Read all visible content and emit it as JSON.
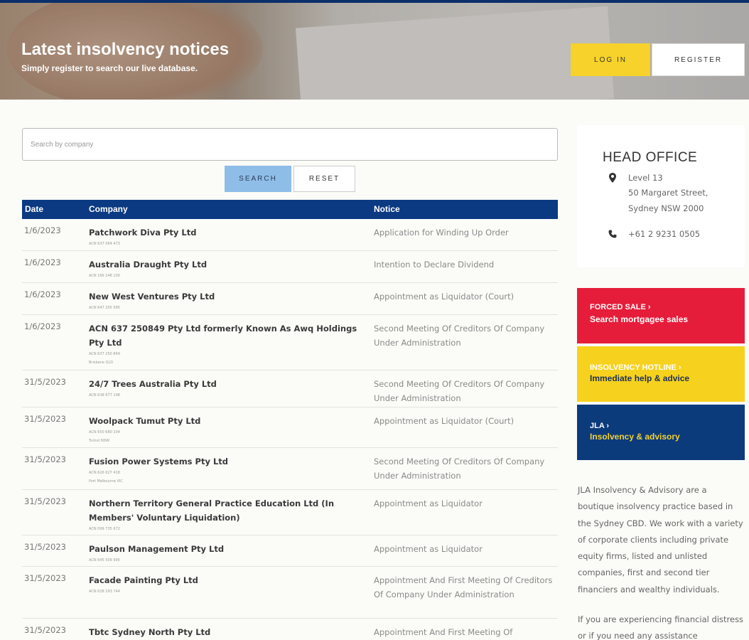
{
  "hero": {
    "title": "Latest insolvency notices",
    "subtitle": "Simply register to search our live database.",
    "login_label": "LOG IN",
    "register_label": "REGISTER"
  },
  "search": {
    "placeholder": "Search by company",
    "search_label": "SEARCH",
    "reset_label": "RESET"
  },
  "table": {
    "headers": {
      "date": "Date",
      "company": "Company",
      "notice": "Notice"
    },
    "rows": [
      {
        "date": "1/6/2023",
        "company": "Patchwork Diva Pty Ltd",
        "sub": [
          "ACN 637 064 473"
        ],
        "notice": "Application for Winding Up Order"
      },
      {
        "date": "1/6/2023",
        "company": "Australia Draught Pty Ltd",
        "sub": [
          "ACN 166 148 100"
        ],
        "notice": "Intention to Declare Dividend"
      },
      {
        "date": "1/6/2023",
        "company": "New West Ventures Pty Ltd",
        "sub": [
          "ACN 647 205 585"
        ],
        "notice": "Appointment as Liquidator (Court)"
      },
      {
        "date": "1/6/2023",
        "company": "ACN 637 250849 Pty Ltd formerly Known As Awq Holdings Pty Ltd",
        "sub": [
          "ACN 637 250 849",
          "Brisbane QLD"
        ],
        "notice": "Second Meeting Of Creditors Of Company Under Administration"
      },
      {
        "date": "31/5/2023",
        "company": "24/7 Trees Australia Pty Ltd",
        "sub": [
          "ACN 638 677 198"
        ],
        "notice": "Second Meeting Of Creditors Of Company Under Administration"
      },
      {
        "date": "31/5/2023",
        "company": "Woolpack Tumut Pty Ltd",
        "sub": [
          "ACN 650 680 204",
          "Tumut NSW"
        ],
        "notice": "Appointment as Liquidator (Court)"
      },
      {
        "date": "31/5/2023",
        "company": "Fusion Power Systems Pty Ltd",
        "sub": [
          "ACN 626 627 418",
          "Port Melbourne VIC"
        ],
        "notice": "Second Meeting Of Creditors Of Company Under Administration"
      },
      {
        "date": "31/5/2023",
        "company": "Northern Territory General Practice Education Ltd (In Members' Voluntary Liquidation)",
        "sub": [
          "ACN 099 735 672"
        ],
        "notice": "Appointment as Liquidator"
      },
      {
        "date": "31/5/2023",
        "company": "Paulson Management Pty Ltd",
        "sub": [
          "ACN 645 509 995"
        ],
        "notice": "Appointment as Liquidator"
      },
      {
        "date": "31/5/2023",
        "company": "Facade Painting Pty Ltd",
        "sub": [
          "ACN 628 293 744"
        ],
        "notice": "Appointment And First Meeting Of Creditors Of Company Under Administration"
      },
      {
        "date": "31/5/2023",
        "company": "Tbtc Sydney North Pty Ltd",
        "sub": [],
        "notice": "Appointment And First Meeting Of"
      }
    ]
  },
  "office": {
    "title": "HEAD OFFICE",
    "address": [
      "Level 13",
      "50 Margaret Street,",
      "Sydney NSW 2000"
    ],
    "phone": "+61 2 9231 0505"
  },
  "promos": [
    {
      "title": "FORCED SALE ›",
      "subtitle": "Search mortgagee sales",
      "bg": "#e61d3a",
      "title_color": "#ffffff",
      "sub_color": "#ffffff"
    },
    {
      "title": "INSOLVENCY HOTLINE ›",
      "subtitle": "Immediate help & advice",
      "bg": "#f6d21e",
      "title_color": "#ffffff",
      "sub_color": "#1d2f55"
    },
    {
      "title": "JLA ›",
      "subtitle": "Insolvency & advisory",
      "bg": "#0c3b7c",
      "title_color": "#ffffff",
      "sub_color": "#f2d230"
    }
  ],
  "about": {
    "paragraph1": "JLA Insolvency & Advisory are a boutique insolvency practice based in the Sydney CBD. We work with a variety of corporate clients including private equity firms, listed and unlisted companies, first and second tier financiers and wealthy individuals.",
    "paragraph2": "If you are experiencing financial distress or if you need any assistance"
  },
  "colors": {
    "navy": "#0b3a82",
    "yellow": "#f6d22a",
    "search_blue": "#8ebde8"
  }
}
